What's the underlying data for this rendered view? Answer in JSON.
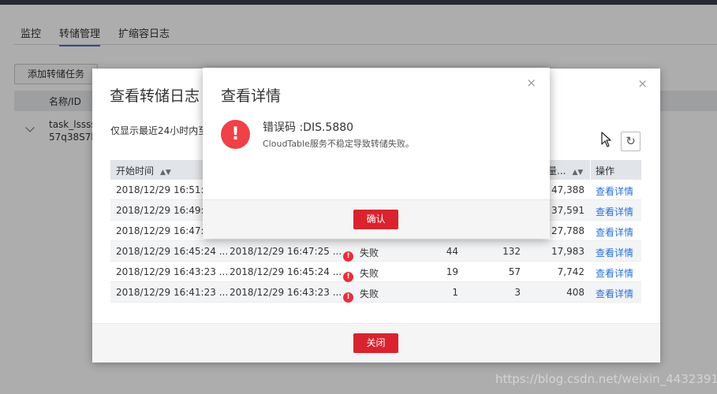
{
  "tabs": [
    "监控",
    "转储管理",
    "扩缩容日志"
  ],
  "add_task_label": "添加转储任务",
  "list_header": "名称/ID",
  "task_row": {
    "line1": "task_lssss",
    "line2": "57q38S7k"
  },
  "log_dialog": {
    "title": "查看转储日志",
    "close_symbol": "×",
    "note": "仅显示最近24小时内至",
    "refresh_symbol": "↻",
    "columns": {
      "start_time": "开始时间",
      "records": "量...",
      "action": "操作"
    },
    "rows": [
      {
        "start": "2018/12/29 16:51:2",
        "end": "",
        "status": "",
        "c1": "",
        "c2": "",
        "c3": "47,388",
        "action": "查看详情"
      },
      {
        "start": "2018/12/29 16:49:2",
        "end": "",
        "status": "",
        "c1": "",
        "c2": "",
        "c3": "37,591",
        "action": "查看详情"
      },
      {
        "start": "2018/12/29 16:47:2",
        "end": "",
        "status": "",
        "c1": "",
        "c2": "",
        "c3": "27,788",
        "action": "查看详情"
      },
      {
        "start": "2018/12/29 16:45:24 ...",
        "end": "2018/12/29 16:47:25 ...",
        "status": "失败",
        "c1": "44",
        "c2": "132",
        "c3": "17,983",
        "action": "查看详情"
      },
      {
        "start": "2018/12/29 16:43:23 ...",
        "end": "2018/12/29 16:45:24 ...",
        "status": "失败",
        "c1": "19",
        "c2": "57",
        "c3": "7,742",
        "action": "查看详情"
      },
      {
        "start": "2018/12/29 16:41:23 ...",
        "end": "2018/12/29 16:43:23 ...",
        "status": "失败",
        "c1": "1",
        "c2": "3",
        "c3": "408",
        "action": "查看详情"
      }
    ],
    "close_button": "关闭"
  },
  "detail_dialog": {
    "title": "查看详情",
    "close_symbol": "×",
    "error_code": "错误码 :DIS.5880",
    "error_message": "CloudTable服务不稳定导致转储失败。",
    "confirm_button": "确认"
  },
  "watermark": "https://blog.csdn.net/weixin_44323916",
  "colors": {
    "accent": "#526ecc",
    "danger": "#d9232e",
    "link": "#2b70d6"
  }
}
